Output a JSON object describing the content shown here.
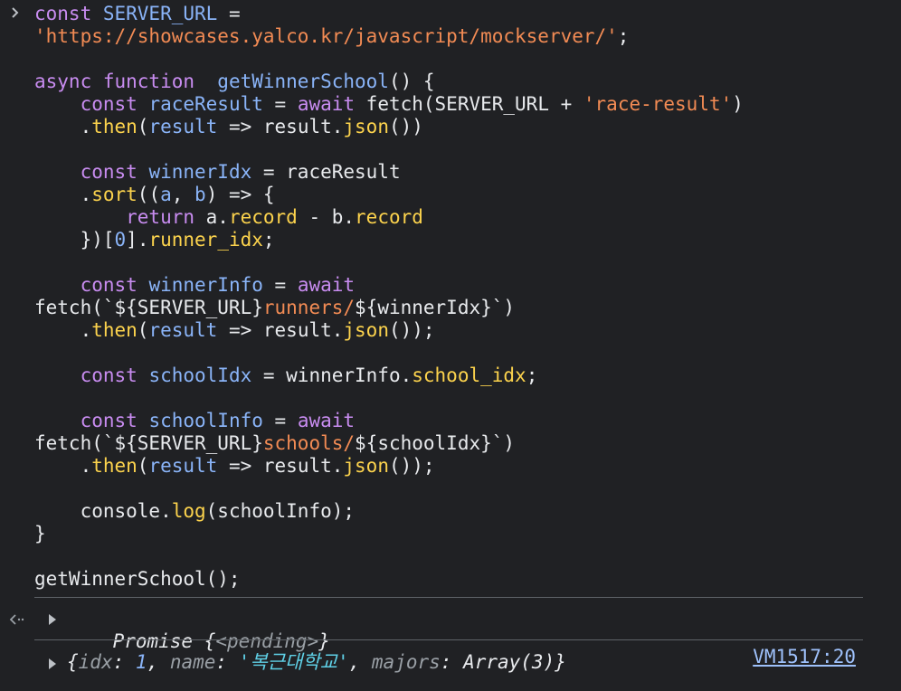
{
  "input": {
    "prompt_icon": "chevron-right-icon",
    "lines": [
      [
        {
          "t": "const ",
          "c": "kw"
        },
        {
          "t": "SERVER_URL",
          "c": "id"
        },
        {
          "t": " =",
          "c": "plain"
        }
      ],
      [
        {
          "t": "'https://showcases.yalco.kr/javascript/mockserver/'",
          "c": "str"
        },
        {
          "t": ";",
          "c": "plain"
        }
      ],
      [],
      [
        {
          "t": "async ",
          "c": "kw"
        },
        {
          "t": "function ",
          "c": "kw"
        },
        {
          "t": " getWinnerSchool",
          "c": "id"
        },
        {
          "t": "() {",
          "c": "plain"
        }
      ],
      [
        {
          "t": "    const ",
          "c": "kw"
        },
        {
          "t": "raceResult",
          "c": "id"
        },
        {
          "t": " = ",
          "c": "plain"
        },
        {
          "t": "await ",
          "c": "kw"
        },
        {
          "t": "fetch(SERVER_URL + ",
          "c": "plain"
        },
        {
          "t": "'race-result'",
          "c": "str"
        },
        {
          "t": ")",
          "c": "plain"
        }
      ],
      [
        {
          "t": "    .",
          "c": "plain"
        },
        {
          "t": "then",
          "c": "fn"
        },
        {
          "t": "(",
          "c": "plain"
        },
        {
          "t": "result",
          "c": "id"
        },
        {
          "t": " => result.",
          "c": "plain"
        },
        {
          "t": "json",
          "c": "fn"
        },
        {
          "t": "())",
          "c": "plain"
        }
      ],
      [],
      [
        {
          "t": "    const ",
          "c": "kw"
        },
        {
          "t": "winnerIdx",
          "c": "id"
        },
        {
          "t": " = raceResult",
          "c": "plain"
        }
      ],
      [
        {
          "t": "    .",
          "c": "plain"
        },
        {
          "t": "sort",
          "c": "fn"
        },
        {
          "t": "((",
          "c": "plain"
        },
        {
          "t": "a",
          "c": "id"
        },
        {
          "t": ", ",
          "c": "plain"
        },
        {
          "t": "b",
          "c": "id"
        },
        {
          "t": ") => {",
          "c": "plain"
        }
      ],
      [
        {
          "t": "        return ",
          "c": "kw"
        },
        {
          "t": "a.",
          "c": "plain"
        },
        {
          "t": "record",
          "c": "fn"
        },
        {
          "t": " - b.",
          "c": "plain"
        },
        {
          "t": "record",
          "c": "fn"
        }
      ],
      [
        {
          "t": "    })[",
          "c": "plain"
        },
        {
          "t": "0",
          "c": "num"
        },
        {
          "t": "].",
          "c": "plain"
        },
        {
          "t": "runner_idx",
          "c": "fn"
        },
        {
          "t": ";",
          "c": "plain"
        }
      ],
      [],
      [
        {
          "t": "    const ",
          "c": "kw"
        },
        {
          "t": "winnerInfo",
          "c": "id"
        },
        {
          "t": " = ",
          "c": "plain"
        },
        {
          "t": "await",
          "c": "kw"
        }
      ],
      [
        {
          "t": "fetch(`${SERVER_URL}",
          "c": "plain"
        },
        {
          "t": "runners/",
          "c": "str"
        },
        {
          "t": "${winnerIdx}`)",
          "c": "plain"
        }
      ],
      [
        {
          "t": "    .",
          "c": "plain"
        },
        {
          "t": "then",
          "c": "fn"
        },
        {
          "t": "(",
          "c": "plain"
        },
        {
          "t": "result",
          "c": "id"
        },
        {
          "t": " => result.",
          "c": "plain"
        },
        {
          "t": "json",
          "c": "fn"
        },
        {
          "t": "());",
          "c": "plain"
        }
      ],
      [],
      [
        {
          "t": "    const ",
          "c": "kw"
        },
        {
          "t": "schoolIdx",
          "c": "id"
        },
        {
          "t": " = winnerInfo.",
          "c": "plain"
        },
        {
          "t": "school_idx",
          "c": "fn"
        },
        {
          "t": ";",
          "c": "plain"
        }
      ],
      [],
      [
        {
          "t": "    const ",
          "c": "kw"
        },
        {
          "t": "schoolInfo",
          "c": "id"
        },
        {
          "t": " = ",
          "c": "plain"
        },
        {
          "t": "await",
          "c": "kw"
        }
      ],
      [
        {
          "t": "fetch(`${SERVER_URL}",
          "c": "plain"
        },
        {
          "t": "schools/",
          "c": "str"
        },
        {
          "t": "${schoolIdx}`)",
          "c": "plain"
        }
      ],
      [
        {
          "t": "    .",
          "c": "plain"
        },
        {
          "t": "then",
          "c": "fn"
        },
        {
          "t": "(",
          "c": "plain"
        },
        {
          "t": "result",
          "c": "id"
        },
        {
          "t": " => result.",
          "c": "plain"
        },
        {
          "t": "json",
          "c": "fn"
        },
        {
          "t": "());",
          "c": "plain"
        }
      ],
      [],
      [
        {
          "t": "    console.",
          "c": "plain"
        },
        {
          "t": "log",
          "c": "fn"
        },
        {
          "t": "(schoolInfo);",
          "c": "plain"
        }
      ],
      [
        {
          "t": "}",
          "c": "plain"
        }
      ],
      [],
      [
        {
          "t": "getWinnerSchool();",
          "c": "plain"
        }
      ]
    ]
  },
  "return_value": {
    "icon": "return-arrow-icon",
    "expand_icon": "expand-triangle-icon",
    "label": "Promise",
    "brace_open": " {",
    "state": "<pending>",
    "brace_close": "}"
  },
  "log_output": {
    "expand_icon": "expand-triangle-icon",
    "prefix": "{",
    "key1": "idx",
    "val1": "1",
    "key2": "name",
    "val2": "'복근대학교'",
    "key3": "majors",
    "val3": "Array(3)",
    "suffix": "}",
    "source_link": "VM1517:20"
  }
}
